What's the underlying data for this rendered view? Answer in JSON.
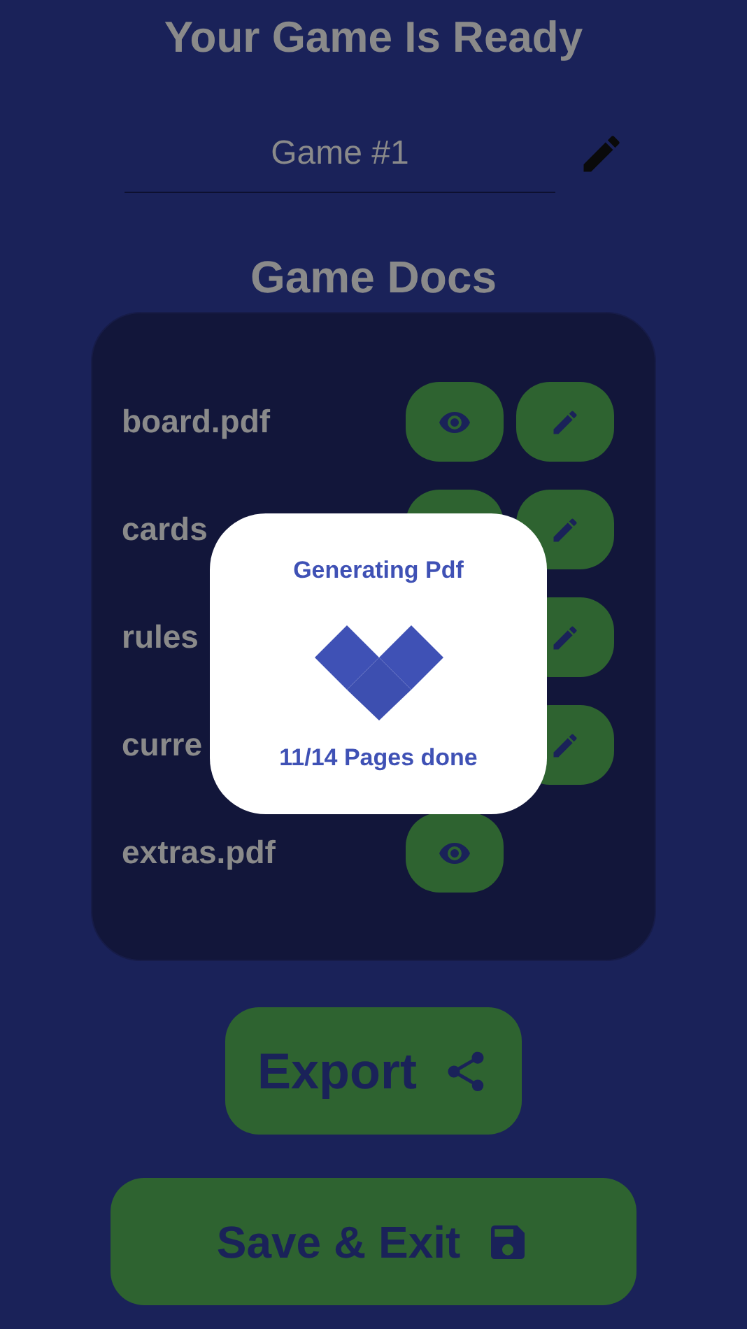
{
  "title": "Your Game Is Ready",
  "game_name": {
    "value": "Game #1"
  },
  "docs_heading": "Game Docs",
  "docs": [
    {
      "name": "board.pdf",
      "buttons": [
        {
          "kind": "view"
        },
        {
          "kind": "edit"
        }
      ]
    },
    {
      "name": "cards",
      "buttons": [
        {
          "kind": "covered"
        },
        {
          "kind": "edit"
        }
      ]
    },
    {
      "name": "rules",
      "buttons": [
        {
          "kind": "edit"
        }
      ]
    },
    {
      "name": "curre",
      "buttons": [
        {
          "kind": "edit"
        }
      ]
    },
    {
      "name": "extras.pdf",
      "buttons": [
        {
          "kind": "view"
        }
      ]
    }
  ],
  "export_button": "Export",
  "save_button": "Save & Exit",
  "dialog": {
    "title": "Generating Pdf",
    "progress": "11/14 Pages done"
  }
}
